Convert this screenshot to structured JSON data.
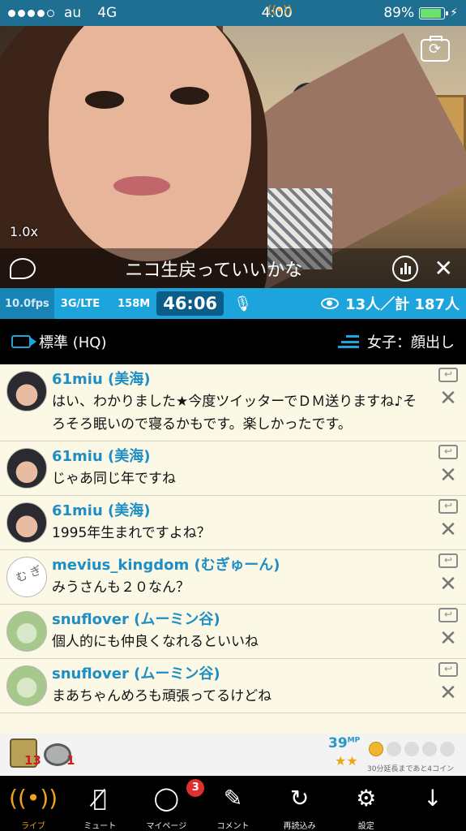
{
  "status_bar": {
    "carrier": "au",
    "network": "4G",
    "time": "4:00",
    "battery": "89%",
    "battery_level": 0.89
  },
  "video": {
    "zoom": "1.0x",
    "caption": "ニコ生戻っていいかな"
  },
  "info_bar": {
    "fps": "10.0fps",
    "net": "3G/LTE",
    "size": "158M",
    "timer": "46:06",
    "viewers": "13人／計 187人"
  },
  "quality_bar": {
    "quality": "標準 (HQ)",
    "category": "女子：顔出し"
  },
  "comments": [
    {
      "name": "61miu (美海)",
      "text": "はい、わかりました★今度ツイッターでＤＭ送りますね♪そろそろ眠いので寝るかもです。楽しかったです。",
      "avatar": "photo"
    },
    {
      "name": "61miu (美海)",
      "text": "じゃあ同じ年ですね",
      "avatar": "photo"
    },
    {
      "name": "61miu (美海)",
      "text": "1995年生まれですよね？",
      "avatar": "photo"
    },
    {
      "name": "mevius_kingdom (むぎゅーん)",
      "text": "みうさんも２０なん？",
      "avatar": "sketch"
    },
    {
      "name": "snuflover (ムーミン谷)",
      "text": "個人的にも仲良くなれるといいね",
      "avatar": "moomin"
    },
    {
      "name": "snuflover (ムーミン谷)",
      "text": "まあちゃんめろも頑張ってるけどね",
      "avatar": "moomin"
    }
  ],
  "gift_bar": {
    "can_count": "13",
    "coin_count": "1",
    "mp": "39",
    "mp_unit": "MP",
    "extend_text": "30分延長まであと4コイン",
    "coins_filled": 1,
    "coins_total": 5
  },
  "tabs": [
    {
      "label": "ライブ",
      "icon": "broadcast-icon"
    },
    {
      "label": "ミュート",
      "icon": "mute-mic-icon"
    },
    {
      "label": "マイページ",
      "icon": "user-icon",
      "badge": "3"
    },
    {
      "label": "コメント",
      "icon": "comment-edit-icon"
    },
    {
      "label": "再読込み",
      "icon": "reload-icon"
    },
    {
      "label": "設定",
      "icon": "gear-icon"
    },
    {
      "label": "",
      "icon": "down-arrow-icon"
    }
  ]
}
